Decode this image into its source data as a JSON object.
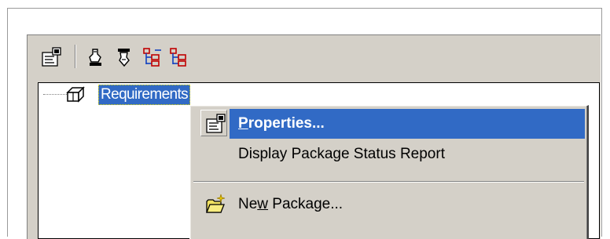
{
  "toolbar": {
    "buttons": [
      {
        "icon": "properties-icon"
      },
      {
        "icon": "check-out-icon"
      },
      {
        "icon": "check-in-icon"
      },
      {
        "icon": "expand-tree-icon"
      },
      {
        "icon": "collapse-tree-icon"
      }
    ]
  },
  "tree": {
    "root": {
      "label": "Requirements",
      "icon": "package-icon"
    }
  },
  "context_menu": {
    "items": [
      {
        "label_pre": "",
        "accel": "P",
        "label_post": "roperties...",
        "icon": "properties-icon",
        "selected": true
      },
      {
        "label": "Display Package Status Report",
        "selected": false
      },
      {
        "label_pre": "Ne",
        "accel": "w",
        "label_post": " Package...",
        "icon": "new-package-icon",
        "selected": false
      }
    ]
  },
  "colors": {
    "selection": "#316ac5",
    "panel": "#d4d0c8"
  }
}
